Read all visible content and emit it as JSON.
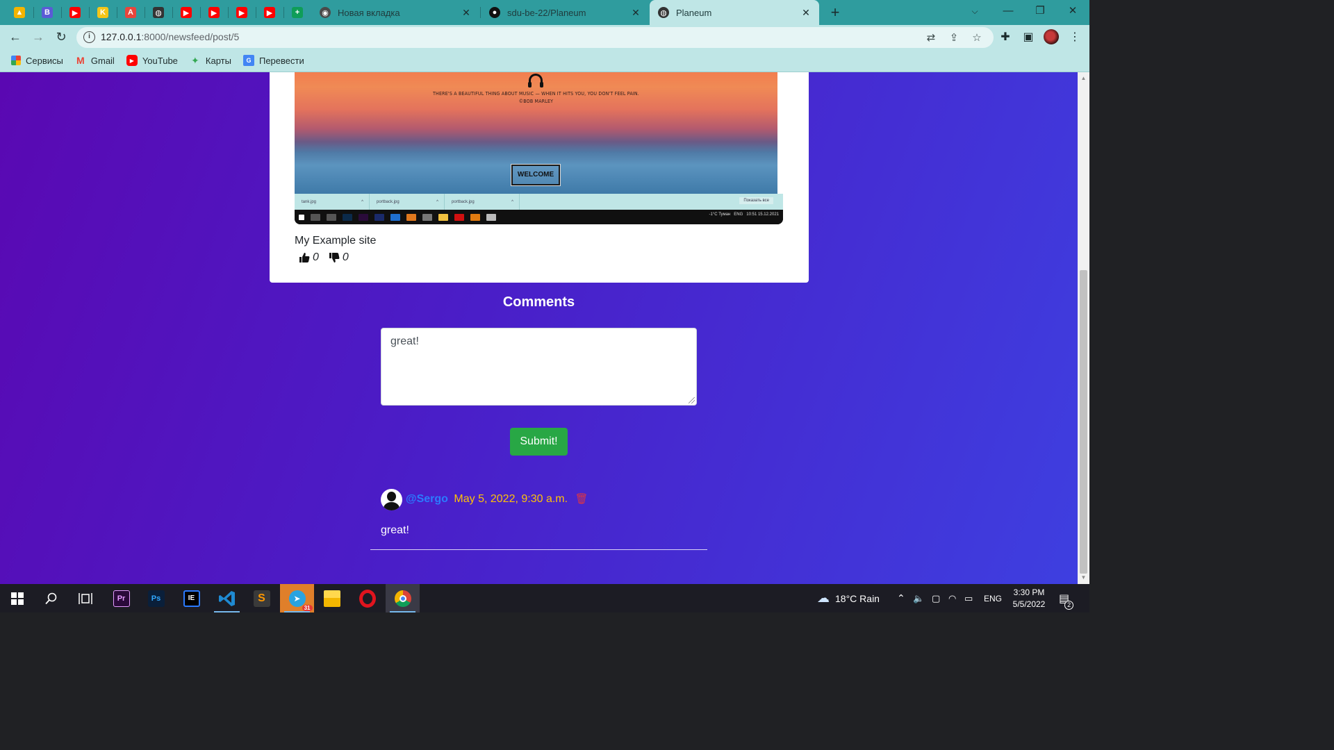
{
  "browser": {
    "pinned_tabs": [
      {
        "name": "google-drive-icon",
        "color": "#f4b400",
        "glyph": "▲"
      },
      {
        "name": "b-app-icon",
        "color": "#5b5bd6",
        "glyph": "B"
      },
      {
        "name": "youtube-icon",
        "color": "#ff0000",
        "glyph": "▶"
      },
      {
        "name": "k-app-icon",
        "color": "#f5c518",
        "glyph": "K"
      },
      {
        "name": "translate-app-icon",
        "color": "#e8453c",
        "glyph": "A"
      },
      {
        "name": "globe-icon",
        "color": "#333333",
        "glyph": "◍"
      },
      {
        "name": "youtube-icon",
        "color": "#ff0000",
        "glyph": "▶"
      },
      {
        "name": "youtube-icon",
        "color": "#ff0000",
        "glyph": "▶"
      },
      {
        "name": "youtube-icon",
        "color": "#ff0000",
        "glyph": "▶"
      },
      {
        "name": "youtube-icon",
        "color": "#ff0000",
        "glyph": "▶"
      },
      {
        "name": "sheets-plus-icon",
        "color": "#0f9d58",
        "glyph": "+"
      }
    ],
    "tabs": [
      {
        "title": "Новая вкладка",
        "icon": "chrome-icon"
      },
      {
        "title": "sdu-be-22/Planeum",
        "icon": "github-icon"
      },
      {
        "title": "Planeum",
        "icon": "globe-icon"
      }
    ],
    "url_host": "127.0.0.1",
    "url_path": ":8000/newsfeed/post/5",
    "bookmarks": [
      {
        "label": "Сервисы",
        "icon": "apps-grid-icon"
      },
      {
        "label": "Gmail",
        "icon": "gmail-icon"
      },
      {
        "label": "YouTube",
        "icon": "youtube-icon"
      },
      {
        "label": "Карты",
        "icon": "maps-icon"
      },
      {
        "label": "Перевести",
        "icon": "translate-icon"
      }
    ]
  },
  "post": {
    "image": {
      "quote_line1": "THERE'S A BEAUTIFUL THING ABOUT MUSIC — WHEN IT HITS YOU, YOU DON'T FEEL PAIN.",
      "quote_line2": "©BOB MARLEY",
      "button": "WELCOME",
      "downloads": [
        "tank.jpg",
        "portback.jpg",
        "portback.jpg"
      ],
      "show_all": "Показать все",
      "tray_text": "-1°C  Туман",
      "tray_lang": "ENG",
      "tray_time": "10:51",
      "tray_date": "15.12.2021"
    },
    "text": "My Example site",
    "likes": "0",
    "dislikes": "0"
  },
  "comments": {
    "title": "Comments",
    "input_value": "great!",
    "submit_label": "Submit!",
    "items": [
      {
        "author": "@Sergo",
        "date": "May 5, 2022, 9:30 a.m.",
        "body": "great!"
      }
    ]
  },
  "taskbar": {
    "weather": "18°C  Rain",
    "lang": "ENG",
    "time": "3:30 PM",
    "date": "5/5/2022",
    "notifications": "2",
    "telegram_badge": "31"
  },
  "colors": {
    "tabstrip": "#2f9c9e",
    "toolbar": "#bfe6e6",
    "page_gradient_start": "#5a08b2",
    "page_gradient_end": "#3e3fe0",
    "author": "#2b7bff",
    "date": "#ffc107",
    "submit": "#28a745",
    "delete": "#dc3545"
  }
}
